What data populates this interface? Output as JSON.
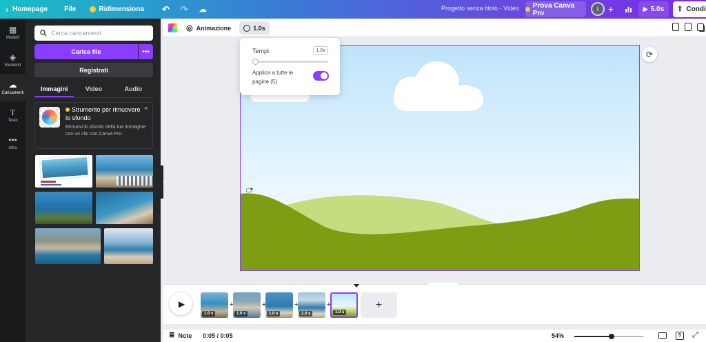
{
  "topbar": {
    "home_label": "Homepage",
    "file_label": "File",
    "resize_label": "Ridimensiona",
    "doc_title": "Progetto senza titolo - Video",
    "pro_label": "Prova Canva Pro",
    "avatar_initial": "I",
    "duration": "5.0s",
    "share_label": "Condiv"
  },
  "rail": [
    {
      "label": "Modelli",
      "icon": "templates-icon"
    },
    {
      "label": "Elementi",
      "icon": "elements-icon"
    },
    {
      "label": "Caricamenti",
      "icon": "upload-icon"
    },
    {
      "label": "Testo",
      "icon": "text-icon"
    },
    {
      "label": "Altro",
      "icon": "more-icon"
    }
  ],
  "panel": {
    "search_placeholder": "Cerca caricamenti",
    "upload_label": "Carica file",
    "upload_more": "•••",
    "record_label": "Registrati",
    "tabs": [
      "Immagini",
      "Video",
      "Audio"
    ],
    "promo_title": "Strumento per rimuovere lo sfondo",
    "promo_desc": "Rimuovi lo sfondo della tua immagine con un clic con Canva Pro.",
    "promo_close": "×"
  },
  "toolbar": {
    "animation_label": "Animazione",
    "duration_label": "1.0s"
  },
  "popover": {
    "timing_label": "Tempi",
    "timing_value": "1.0s",
    "slider_value": 0,
    "apply_label": "Applica a tutte le pagine (5)",
    "apply_on": true
  },
  "timeline": {
    "clips": [
      "1.0 s",
      "1.0 s",
      "1.0 s",
      "1.0 s",
      "1.0 s"
    ]
  },
  "footer": {
    "notes_label": "Note",
    "time_label": "0:05 / 0:05",
    "zoom_label": "54%",
    "zoom_value": 0.54,
    "pages_label": "5"
  },
  "colors": {
    "accent": "#8b3dff",
    "ground": "#7f9d12",
    "ground_light": "#c5dd80",
    "sky_top": "#bfe3fa"
  }
}
